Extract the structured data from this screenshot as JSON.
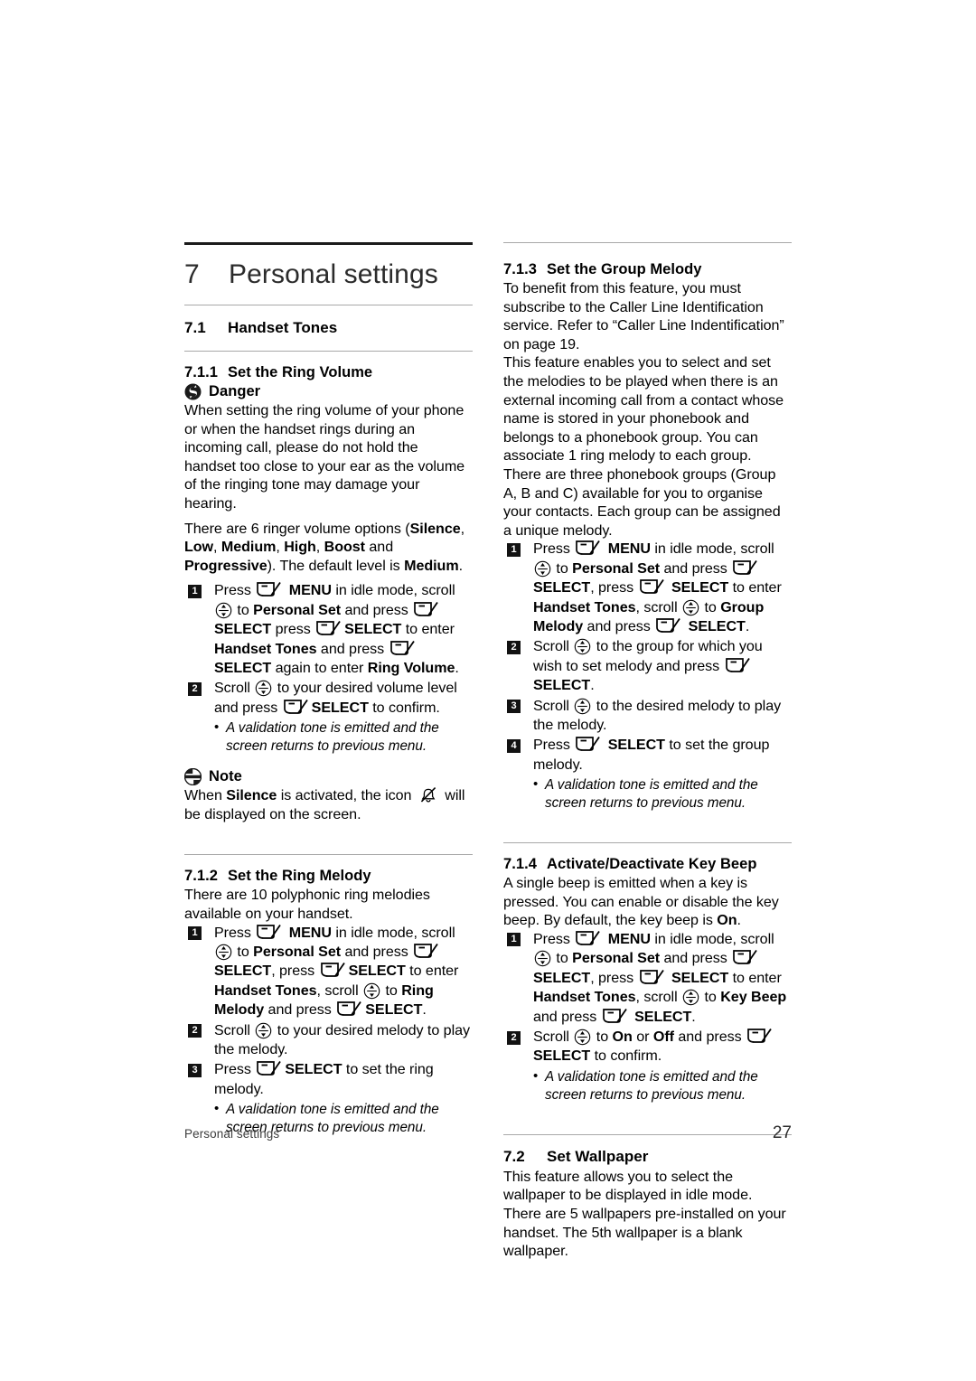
{
  "chapter": {
    "number": "7",
    "title": "Personal settings"
  },
  "left_column": {
    "section_71": {
      "number": "7.1",
      "title": "Handset Tones"
    },
    "section_711": {
      "number": "7.1.1",
      "title": "Set the Ring Volume",
      "danger_label": "Danger",
      "danger_text": "When setting the ring volume of your phone or when the handset rings during an incoming call, please do not hold the handset too close to your ear as the volume of the ringing tone may damage your hearing.",
      "options_intro": "There are 6 ringer volume options (",
      "options": [
        "Silence",
        "Low",
        "Medium",
        "High",
        "Boost",
        "Progressive"
      ],
      "options_mid": ", ",
      "options_and": " and ",
      "options_close": "). The default level is ",
      "default_level": "Medium",
      "options_end": ".",
      "steps": [
        {
          "num": "1",
          "p1": "Press ",
          "p2": " MENU",
          "p3": " in idle mode, scroll ",
          "p4": " to ",
          "p5": "Personal Set",
          "p6": " and press ",
          "p7": " SELECT",
          "p8": " press ",
          "p9": "SELECT",
          "p10": " to enter ",
          "p11": "Handset Tones",
          "p12": " and press ",
          "p13": "SELECT",
          "p14": " again to enter ",
          "p15": "Ring Volume",
          "p16": "."
        },
        {
          "num": "2",
          "p1": "Scroll ",
          "p2": " to your desired volume level and press ",
          "p3": "SELECT",
          "p4": " to confirm."
        }
      ],
      "bullet": "A validation tone is emitted and the screen returns to previous menu.",
      "note_label": "Note",
      "note_pre": "When ",
      "note_bold": "Silence",
      "note_mid": " is activated, the icon ",
      "note_post": " will be displayed on the screen."
    },
    "section_712": {
      "number": "7.1.2",
      "title": "Set the Ring Melody",
      "intro": "There are 10 polyphonic ring melodies available on your handset.",
      "steps": [
        {
          "num": "1",
          "p1": "Press ",
          "p2": " MENU",
          "p3": " in idle mode, scroll ",
          "p4": " to ",
          "p5": "Personal Set",
          "p6": " and press ",
          "p7": "SELECT",
          "p8": ", press ",
          "p9": "SELECT",
          "p10": " to enter ",
          "p11": "Handset Tones",
          "p12": ", scroll ",
          "p13": " to ",
          "p14": "Ring Melody",
          "p15": " and press ",
          "p16": "SELECT",
          "p17": "."
        },
        {
          "num": "2",
          "p1": "Scroll ",
          "p2": " to your desired melody to play the melody."
        },
        {
          "num": "3",
          "p1": "Press ",
          "p2": "SELECT",
          "p3": " to set the ring melody."
        }
      ],
      "bullet": "A validation tone is emitted and the screen returns to previous menu."
    }
  },
  "right_column": {
    "section_713": {
      "number": "7.1.3",
      "title": "Set the Group Melody",
      "para1": "To benefit from this feature, you must subscribe to the Caller Line Identification service. Refer to “Caller Line Indentification” on page 19.",
      "para2": "This feature enables you to select and set the melodies to be played when there is an external incoming call from a contact whose name is stored in your phonebook and belongs to a phonebook group. You can associate 1 ring melody to each group.",
      "para3": "There are three phonebook groups (Group A, B and C) available for you to organise your contacts. Each group can be assigned a unique melody.",
      "steps": [
        {
          "num": "1",
          "p1": "Press ",
          "p2": " MENU",
          "p3": " in idle mode, scroll ",
          "p4": " to ",
          "p5": "Personal Set",
          "p6": " and press ",
          "p7": " SELECT",
          "p8": ", press ",
          "p9": " SELECT",
          "p10": " to enter ",
          "p11": "Handset Tones",
          "p12": ", scroll ",
          "p13": " to ",
          "p14": "Group Melody",
          "p15": " and press ",
          "p16": " SELECT",
          "p17": "."
        },
        {
          "num": "2",
          "p1": "Scroll ",
          "p2": " to the group for which you wish to set melody and press ",
          "p3": " SELECT",
          "p4": "."
        },
        {
          "num": "3",
          "p1": "Scroll ",
          "p2": " to the desired melody to play the melody."
        },
        {
          "num": "4",
          "p1": "Press ",
          "p2": " SELECT",
          "p3": " to set the group melody."
        }
      ],
      "bullet": "A validation tone is emitted and the screen returns to previous menu."
    },
    "section_714": {
      "number": "7.1.4",
      "title": "Activate/Deactivate Key Beep",
      "intro_pre": "A single beep is emitted when a key is pressed. You can enable or disable the key beep. By default, the key beep is ",
      "intro_bold": "On",
      "intro_post": ".",
      "steps": [
        {
          "num": "1",
          "p1": "Press ",
          "p2": " MENU",
          "p3": " in idle mode, scroll ",
          "p4": " to ",
          "p5": "Personal Set",
          "p6": " and press ",
          "p7": " SELECT",
          "p8": ", press ",
          "p9": " SELECT",
          "p10": " to enter ",
          "p11": "Handset Tones",
          "p12": ", scroll ",
          "p13": " to ",
          "p14": "Key Beep",
          "p15": " and press ",
          "p16": " SELECT",
          "p17": "."
        },
        {
          "num": "2",
          "p1": "Scroll ",
          "p2": " to ",
          "p3": "On",
          "p4": " or ",
          "p5": "Off",
          "p6": " and press ",
          "p7": "SELECT",
          "p8": " to confirm."
        }
      ],
      "bullet": "A validation tone is emitted and the screen returns to previous menu."
    },
    "section_72": {
      "number": "7.2",
      "title": "Set Wallpaper",
      "para": "This feature allows you to select the wallpaper to be displayed in idle mode. There are 5 wallpapers pre-installed on your handset. The 5th wallpaper is a blank wallpaper."
    }
  },
  "footer": {
    "left": "Personal settings",
    "page": "27"
  },
  "icons": {
    "soft_key": "soft-key-icon",
    "nav_key": "nav-key-icon",
    "danger": "danger-icon",
    "note": "note-icon",
    "silence_bell": "silence-bell-icon"
  }
}
